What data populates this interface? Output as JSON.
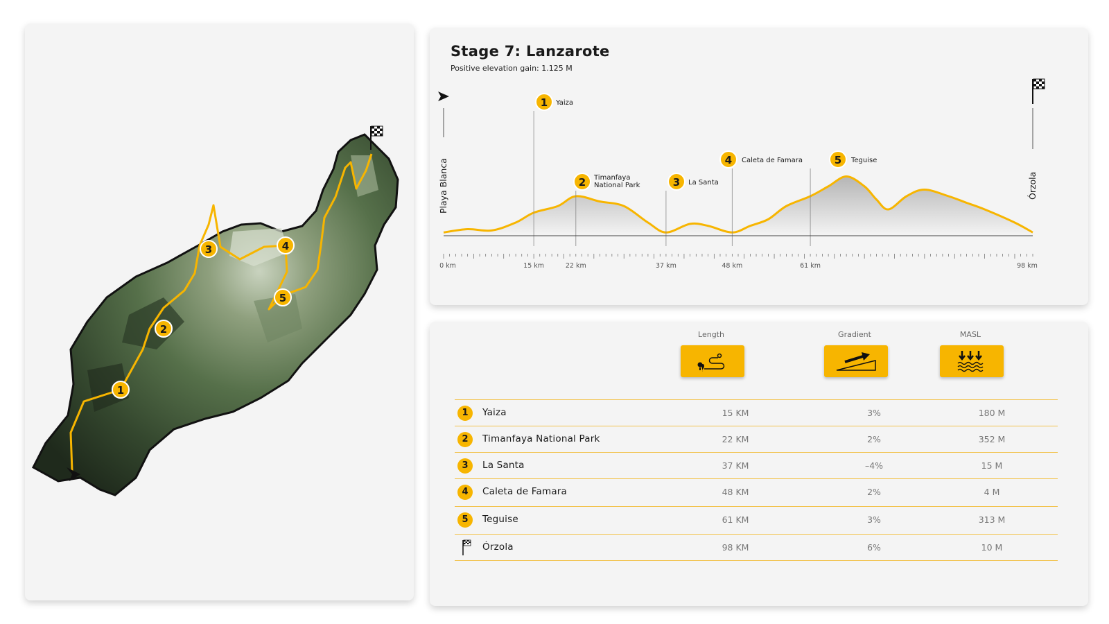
{
  "profile": {
    "title": "Stage 7: Lanzarote",
    "subtitle": "Positive elevation gain: 1.125 M",
    "start_label": "Playa Blanca",
    "end_label": "Órzola",
    "ticks": [
      "0 km",
      "15 km",
      "22 km",
      "37 km",
      "48 km",
      "61 km",
      "98 km"
    ],
    "waypoints": [
      {
        "num": "1",
        "name": "Yaiza"
      },
      {
        "num": "2",
        "name_line1": "Timanfaya",
        "name_line2": "National Park"
      },
      {
        "num": "3",
        "name": "La Santa"
      },
      {
        "num": "4",
        "name": "Caleta de Famara"
      },
      {
        "num": "5",
        "name": "Teguise"
      }
    ]
  },
  "chart_data": {
    "type": "area",
    "x_unit": "km",
    "x": [
      0,
      4,
      8,
      12,
      15,
      19,
      22,
      26,
      30,
      34,
      37,
      41,
      44,
      48,
      51,
      54,
      57,
      61,
      64,
      67,
      70,
      72,
      74,
      77,
      80,
      84,
      87,
      90,
      95,
      98
    ],
    "y": [
      5,
      10,
      8,
      20,
      35,
      45,
      60,
      52,
      45,
      20,
      5,
      18,
      15,
      5,
      15,
      25,
      45,
      60,
      75,
      90,
      75,
      55,
      40,
      60,
      70,
      60,
      50,
      40,
      20,
      5
    ],
    "xlim": [
      0,
      98
    ],
    "markers_km": [
      15,
      22,
      37,
      48,
      61
    ]
  },
  "table": {
    "headers": [
      "Length",
      "Gradient",
      "MASL"
    ],
    "icons": [
      "route-length-icon",
      "gradient-icon",
      "sea-level-icon"
    ],
    "rows": [
      {
        "badge": "1",
        "name": "Yaiza",
        "length": "15 KM",
        "gradient": "3%",
        "masl": "180 M"
      },
      {
        "badge": "2",
        "name": "Timanfaya National Park",
        "length": "22 KM",
        "gradient": "2%",
        "masl": "352 M"
      },
      {
        "badge": "3",
        "name": "La Santa",
        "length": "37 KM",
        "gradient": "–4%",
        "masl": "15 M"
      },
      {
        "badge": "4",
        "name": "Caleta de Famara",
        "length": "48 KM",
        "gradient": "2%",
        "masl": "4 M"
      },
      {
        "badge": "5",
        "name": "Teguise",
        "length": "61 KM",
        "gradient": "3%",
        "masl": "313 M"
      },
      {
        "badge": "",
        "name": "Órzola",
        "length": "98 KM",
        "gradient": "6%",
        "masl": "10 M"
      }
    ]
  },
  "map": {
    "route_markers": [
      "1",
      "2",
      "3",
      "4",
      "5"
    ]
  },
  "colors": {
    "accent": "#f7b500",
    "card": "#f4f4f4",
    "terrain_dark": "#2b3a26",
    "terrain_light": "#8fa07e"
  }
}
